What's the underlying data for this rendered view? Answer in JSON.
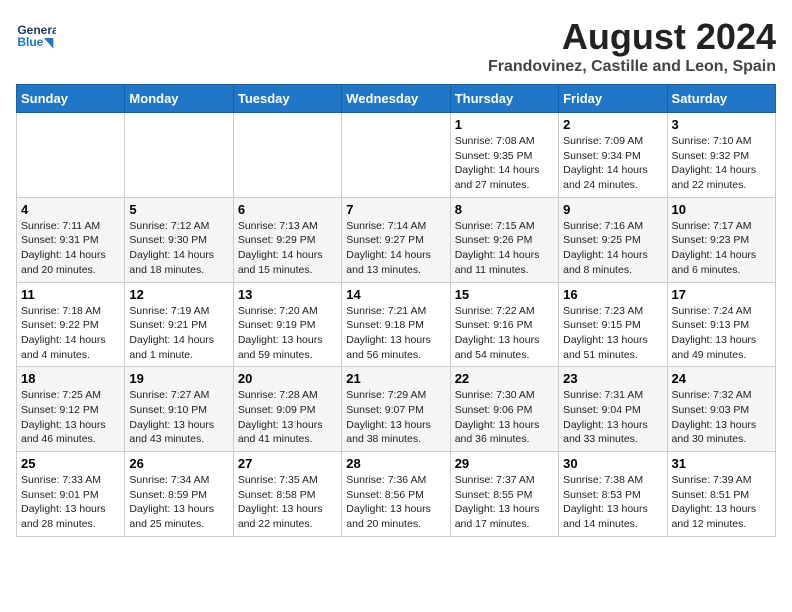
{
  "header": {
    "logo_line1": "General",
    "logo_line2": "Blue",
    "main_title": "August 2024",
    "subtitle": "Frandovinez, Castille and Leon, Spain"
  },
  "weekdays": [
    "Sunday",
    "Monday",
    "Tuesday",
    "Wednesday",
    "Thursday",
    "Friday",
    "Saturday"
  ],
  "weeks": [
    [
      {
        "day": "",
        "info": ""
      },
      {
        "day": "",
        "info": ""
      },
      {
        "day": "",
        "info": ""
      },
      {
        "day": "",
        "info": ""
      },
      {
        "day": "1",
        "info": "Sunrise: 7:08 AM\nSunset: 9:35 PM\nDaylight: 14 hours and 27 minutes."
      },
      {
        "day": "2",
        "info": "Sunrise: 7:09 AM\nSunset: 9:34 PM\nDaylight: 14 hours and 24 minutes."
      },
      {
        "day": "3",
        "info": "Sunrise: 7:10 AM\nSunset: 9:32 PM\nDaylight: 14 hours and 22 minutes."
      }
    ],
    [
      {
        "day": "4",
        "info": "Sunrise: 7:11 AM\nSunset: 9:31 PM\nDaylight: 14 hours and 20 minutes."
      },
      {
        "day": "5",
        "info": "Sunrise: 7:12 AM\nSunset: 9:30 PM\nDaylight: 14 hours and 18 minutes."
      },
      {
        "day": "6",
        "info": "Sunrise: 7:13 AM\nSunset: 9:29 PM\nDaylight: 14 hours and 15 minutes."
      },
      {
        "day": "7",
        "info": "Sunrise: 7:14 AM\nSunset: 9:27 PM\nDaylight: 14 hours and 13 minutes."
      },
      {
        "day": "8",
        "info": "Sunrise: 7:15 AM\nSunset: 9:26 PM\nDaylight: 14 hours and 11 minutes."
      },
      {
        "day": "9",
        "info": "Sunrise: 7:16 AM\nSunset: 9:25 PM\nDaylight: 14 hours and 8 minutes."
      },
      {
        "day": "10",
        "info": "Sunrise: 7:17 AM\nSunset: 9:23 PM\nDaylight: 14 hours and 6 minutes."
      }
    ],
    [
      {
        "day": "11",
        "info": "Sunrise: 7:18 AM\nSunset: 9:22 PM\nDaylight: 14 hours and 4 minutes."
      },
      {
        "day": "12",
        "info": "Sunrise: 7:19 AM\nSunset: 9:21 PM\nDaylight: 14 hours and 1 minute."
      },
      {
        "day": "13",
        "info": "Sunrise: 7:20 AM\nSunset: 9:19 PM\nDaylight: 13 hours and 59 minutes."
      },
      {
        "day": "14",
        "info": "Sunrise: 7:21 AM\nSunset: 9:18 PM\nDaylight: 13 hours and 56 minutes."
      },
      {
        "day": "15",
        "info": "Sunrise: 7:22 AM\nSunset: 9:16 PM\nDaylight: 13 hours and 54 minutes."
      },
      {
        "day": "16",
        "info": "Sunrise: 7:23 AM\nSunset: 9:15 PM\nDaylight: 13 hours and 51 minutes."
      },
      {
        "day": "17",
        "info": "Sunrise: 7:24 AM\nSunset: 9:13 PM\nDaylight: 13 hours and 49 minutes."
      }
    ],
    [
      {
        "day": "18",
        "info": "Sunrise: 7:25 AM\nSunset: 9:12 PM\nDaylight: 13 hours and 46 minutes."
      },
      {
        "day": "19",
        "info": "Sunrise: 7:27 AM\nSunset: 9:10 PM\nDaylight: 13 hours and 43 minutes."
      },
      {
        "day": "20",
        "info": "Sunrise: 7:28 AM\nSunset: 9:09 PM\nDaylight: 13 hours and 41 minutes."
      },
      {
        "day": "21",
        "info": "Sunrise: 7:29 AM\nSunset: 9:07 PM\nDaylight: 13 hours and 38 minutes."
      },
      {
        "day": "22",
        "info": "Sunrise: 7:30 AM\nSunset: 9:06 PM\nDaylight: 13 hours and 36 minutes."
      },
      {
        "day": "23",
        "info": "Sunrise: 7:31 AM\nSunset: 9:04 PM\nDaylight: 13 hours and 33 minutes."
      },
      {
        "day": "24",
        "info": "Sunrise: 7:32 AM\nSunset: 9:03 PM\nDaylight: 13 hours and 30 minutes."
      }
    ],
    [
      {
        "day": "25",
        "info": "Sunrise: 7:33 AM\nSunset: 9:01 PM\nDaylight: 13 hours and 28 minutes."
      },
      {
        "day": "26",
        "info": "Sunrise: 7:34 AM\nSunset: 8:59 PM\nDaylight: 13 hours and 25 minutes."
      },
      {
        "day": "27",
        "info": "Sunrise: 7:35 AM\nSunset: 8:58 PM\nDaylight: 13 hours and 22 minutes."
      },
      {
        "day": "28",
        "info": "Sunrise: 7:36 AM\nSunset: 8:56 PM\nDaylight: 13 hours and 20 minutes."
      },
      {
        "day": "29",
        "info": "Sunrise: 7:37 AM\nSunset: 8:55 PM\nDaylight: 13 hours and 17 minutes."
      },
      {
        "day": "30",
        "info": "Sunrise: 7:38 AM\nSunset: 8:53 PM\nDaylight: 13 hours and 14 minutes."
      },
      {
        "day": "31",
        "info": "Sunrise: 7:39 AM\nSunset: 8:51 PM\nDaylight: 13 hours and 12 minutes."
      }
    ]
  ]
}
